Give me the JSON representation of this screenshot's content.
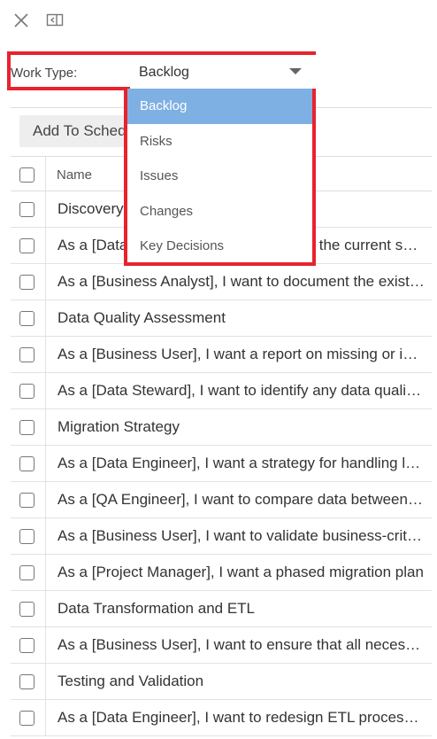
{
  "toolbar": {
    "close_icon": "close-icon",
    "panel_icon": "collapse-panel-icon"
  },
  "filter": {
    "label": "Work Type:",
    "selected": "Backlog",
    "options": [
      "Backlog",
      "Risks",
      "Issues",
      "Changes",
      "Key Decisions"
    ]
  },
  "actions": {
    "add_to_schedule": "Add To Schedule"
  },
  "table": {
    "header": "Name",
    "rows": [
      "Discovery",
      "As a [Data Architect], I want to analyze the current system",
      "As a [Business Analyst], I want to document the existing processes",
      "Data Quality Assessment",
      "As a [Business User], I want a report on missing or invalid data",
      "As a [Data Steward], I want to identify any data quality issues",
      "Migration Strategy",
      "As a [Data Engineer], I want a strategy for handling large volumes",
      "As a [QA Engineer], I want to compare data between systems",
      "As a [Business User], I want to validate business-critical data",
      "As a [Project Manager], I want a phased migration plan",
      "Data Transformation and ETL",
      "As a [Business User], I want to ensure that all necessary data",
      "Testing and Validation",
      "As a [Data Engineer], I want to redesign ETL processes"
    ]
  },
  "colors": {
    "highlight": "#e8232d",
    "selected_option": "#7fb0e3"
  }
}
